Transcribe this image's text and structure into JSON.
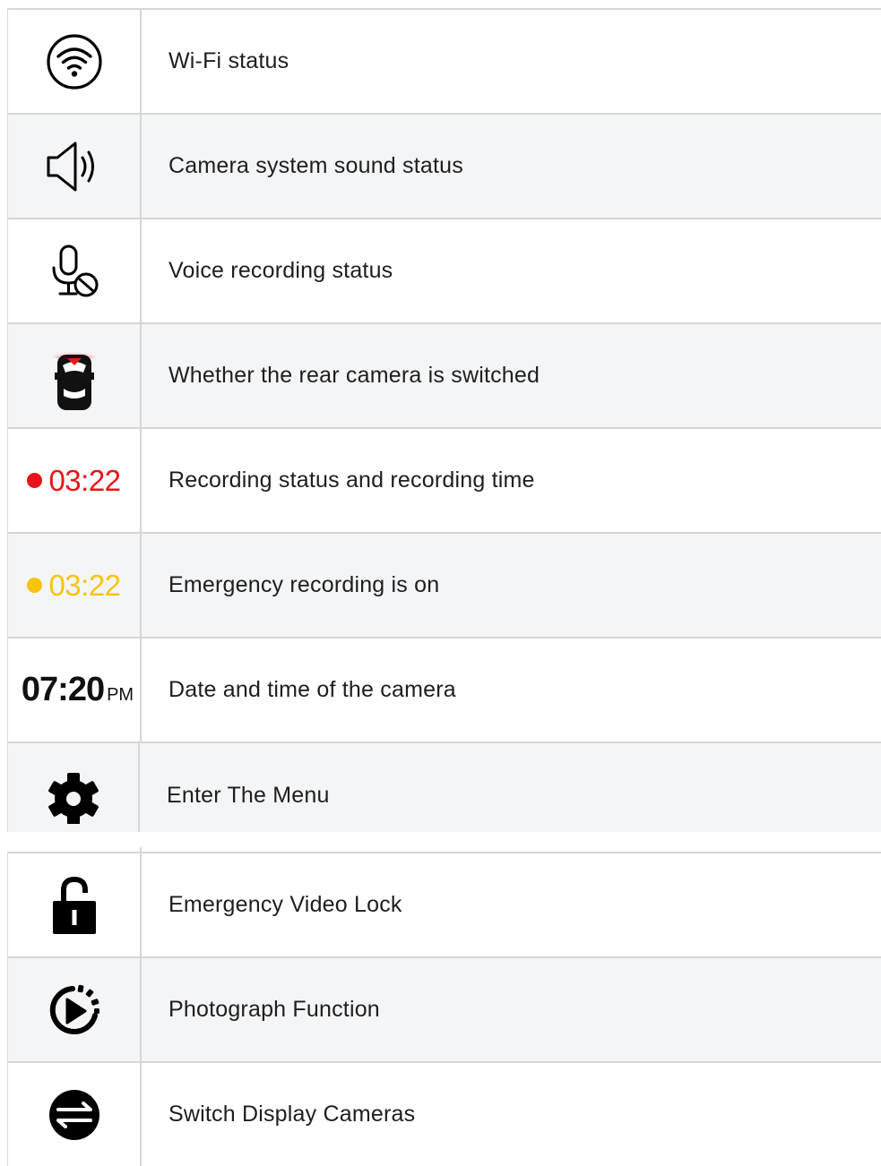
{
  "rows_group1": [
    {
      "icon": "wifi-icon",
      "label": "Wi-Fi status"
    },
    {
      "icon": "speaker-icon",
      "label": "Camera system sound status"
    },
    {
      "icon": "mic-off-icon",
      "label": "Voice recording status"
    },
    {
      "icon": "rear-camera-car-icon",
      "label": "Whether the rear camera is switched"
    },
    {
      "icon": "recording-timer",
      "timer": "03:22",
      "dot_color": "#e8141a",
      "label": "Recording status and recording time"
    },
    {
      "icon": "emergency-timer",
      "timer": "03:22",
      "dot_color": "#f6c40a",
      "label": "Emergency recording is on"
    },
    {
      "icon": "clock",
      "time": "07:20",
      "ampm": "PM",
      "label": "Date and time of the camera"
    },
    {
      "icon": "gear-icon",
      "label": "Enter The Menu"
    }
  ],
  "rows_group2": [
    {
      "icon": "unlock-icon",
      "label": "Emergency Video Lock"
    },
    {
      "icon": "photo-timer-icon",
      "label": "Photograph Function"
    },
    {
      "icon": "switch-cameras-icon",
      "label": "Switch Display Cameras"
    }
  ],
  "colors": {
    "recording_red": "#e8141a",
    "emergency_yellow": "#f6c40a",
    "row_alt_bg": "#f4f5f7",
    "border": "#d6d6d6"
  }
}
